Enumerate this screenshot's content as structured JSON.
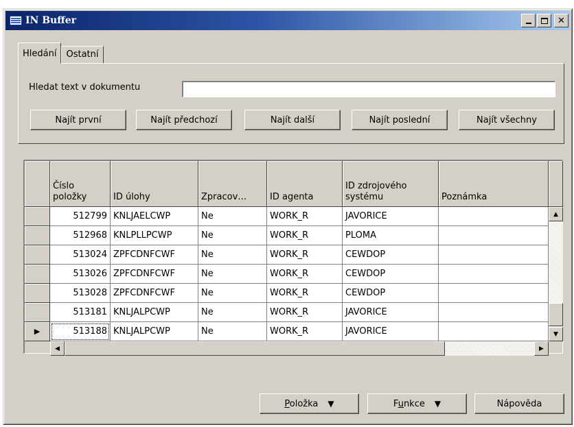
{
  "window": {
    "title": "IN Buffer"
  },
  "tabs": [
    {
      "label": "Hledání",
      "active": true
    },
    {
      "label": "Ostatní",
      "active": false
    }
  ],
  "search": {
    "label": "Hledat text v dokumentu",
    "value": ""
  },
  "find_buttons": [
    "Najít první",
    "Najít předchozí",
    "Najít další",
    "Najít poslední",
    "Najít všechny"
  ],
  "grid": {
    "columns": [
      "Číslo\npoložky",
      "ID úlohy",
      "Zpracov…",
      "ID agenta",
      "ID zdrojového\nsystému",
      "Poznámka"
    ],
    "rows": [
      [
        "512799",
        "KNLJAELCWP",
        "Ne",
        "WORK_R",
        "JAVORICE",
        ""
      ],
      [
        "512968",
        "KNLPLLPCWP",
        "Ne",
        "WORK_R",
        "PLOMA",
        ""
      ],
      [
        "513024",
        "ZPFCDNFCWF",
        "Ne",
        "WORK_R",
        "CEWDOP",
        ""
      ],
      [
        "513026",
        "ZPFCDNFCWF",
        "Ne",
        "WORK_R",
        "CEWDOP",
        ""
      ],
      [
        "513028",
        "ZPFCDNFCWF",
        "Ne",
        "WORK_R",
        "CEWDOP",
        ""
      ],
      [
        "513181",
        "KNLJALPCWP",
        "Ne",
        "WORK_R",
        "JAVORICE",
        ""
      ],
      [
        "513188",
        "KNLJALPCWP",
        "Ne",
        "WORK_R",
        "JAVORICE",
        ""
      ]
    ],
    "current_row_marker": "▶"
  },
  "bottom_buttons": {
    "item": {
      "pre": "",
      "accel": "P",
      "post": "oložka"
    },
    "function": {
      "pre": "F",
      "accel": "u",
      "post": "nkce"
    },
    "help": "Nápověda"
  },
  "icons": {
    "dropdown": "▼",
    "scroll_up": "▲",
    "scroll_down": "▼",
    "scroll_left": "◀",
    "scroll_right": "▶"
  }
}
